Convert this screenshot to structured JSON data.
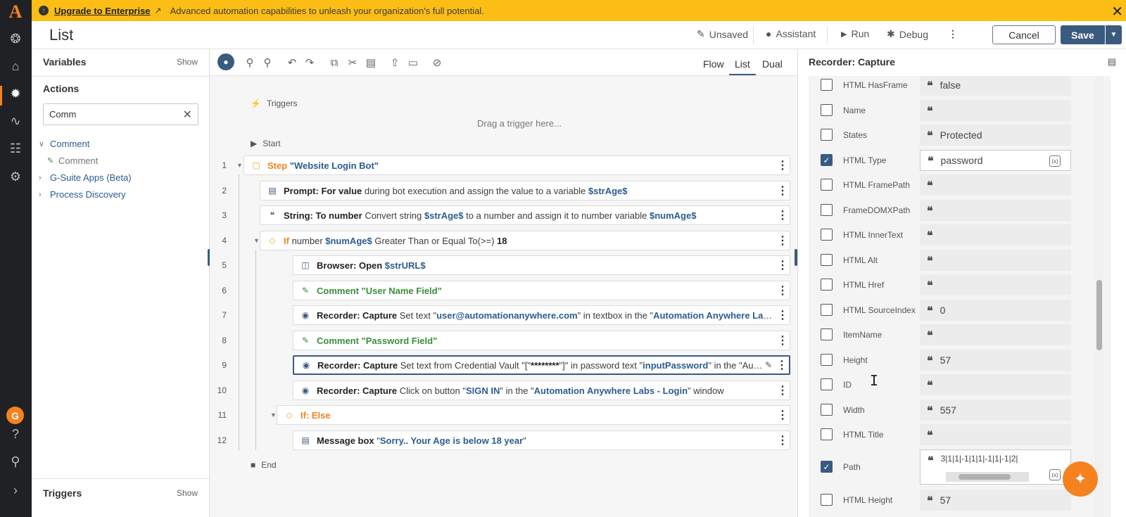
{
  "banner": {
    "link": "Upgrade to Enterprise",
    "message": "Advanced automation capabilities to unleash your organization's full potential."
  },
  "header": {
    "title": "List",
    "unsaved": "Unsaved",
    "assistant": "Assistant",
    "run": "Run",
    "debug": "Debug",
    "cancel": "Cancel",
    "save": "Save"
  },
  "rail": {
    "avatar_initial": "G"
  },
  "left_panel": {
    "variables": "Variables",
    "variables_show": "Show",
    "actions": "Actions",
    "search_value": "Comm",
    "tree": [
      {
        "label": "Comment",
        "expanded": true
      },
      {
        "label": "Comment",
        "child": true
      },
      {
        "label": "G-Suite Apps (Beta)"
      },
      {
        "label": "Process Discovery"
      }
    ],
    "triggers": "Triggers",
    "triggers_show": "Show"
  },
  "toolbar": {
    "tabs": [
      "Flow",
      "List",
      "Dual"
    ],
    "active_tab": "List"
  },
  "canvas": {
    "triggers_label": "Triggers",
    "drag_hint": "Drag a trigger here...",
    "start_label": "Start",
    "end_label": "End",
    "lines": [
      {
        "no": "1",
        "parts": [
          [
            "step",
            "Step "
          ],
          [
            "str",
            "\"Website Login Bot\""
          ]
        ]
      },
      {
        "no": "2",
        "parts": [
          [
            "act",
            "Prompt: For value"
          ],
          [
            "",
            " during bot execution and assign the value to a variable "
          ],
          [
            "var",
            "$strAge$"
          ]
        ]
      },
      {
        "no": "3",
        "parts": [
          [
            "act",
            "String: To number"
          ],
          [
            "",
            " Convert string "
          ],
          [
            "var",
            "$strAge$"
          ],
          [
            "",
            " to a number and assign it to number variable "
          ],
          [
            "var",
            "$numAge$"
          ]
        ]
      },
      {
        "no": "4",
        "parts": [
          [
            "step",
            "If"
          ],
          [
            "",
            " number "
          ],
          [
            "var",
            "$numAge$"
          ],
          [
            "",
            " Greater Than or Equal To(>=) "
          ],
          [
            "act",
            "18"
          ]
        ]
      },
      {
        "no": "5",
        "parts": [
          [
            "act",
            "Browser: Open "
          ],
          [
            "var",
            "$strURL$"
          ]
        ]
      },
      {
        "no": "6",
        "parts": [
          [
            "cmt",
            "Comment \"User Name Field\""
          ]
        ]
      },
      {
        "no": "7",
        "parts": [
          [
            "act",
            "Recorder: Capture"
          ],
          [
            "",
            " Set text \""
          ],
          [
            "var",
            "user@automationanywhere.com"
          ],
          [
            "",
            "\" in textbox in the \""
          ],
          [
            "var",
            "Automation Anywhere Labs - Login"
          ],
          [
            "",
            "\" window"
          ]
        ]
      },
      {
        "no": "8",
        "parts": [
          [
            "cmt",
            "Comment \"Password Field\""
          ]
        ]
      },
      {
        "no": "9",
        "parts": [
          [
            "act",
            "Recorder: Capture"
          ],
          [
            "",
            " Set text from Credential Vault \"[\""
          ],
          [
            "act",
            "********"
          ],
          [
            "",
            "\"]\" in password text \""
          ],
          [
            "var",
            "inputPassword"
          ],
          [
            "",
            "\" in the \"Automation Anywhere Labs - Login\" window"
          ]
        ]
      },
      {
        "no": "10",
        "parts": [
          [
            "act",
            "Recorder: Capture"
          ],
          [
            "",
            " Click on button \""
          ],
          [
            "var",
            "SIGN IN"
          ],
          [
            "",
            "\" in the \""
          ],
          [
            "var",
            "Automation Anywhere Labs - Login"
          ],
          [
            "",
            "\" window"
          ]
        ]
      },
      {
        "no": "11",
        "parts": [
          [
            "step",
            "If: Else"
          ]
        ]
      },
      {
        "no": "12",
        "parts": [
          [
            "act",
            "Message box"
          ],
          [
            "",
            " \""
          ],
          [
            "var",
            "Sorry.. Your Age is below 18 year"
          ],
          [
            "",
            "\""
          ]
        ]
      }
    ]
  },
  "right_panel": {
    "title": "Recorder: Capture",
    "props": [
      {
        "label": "HTML HasFrame",
        "value": "false",
        "checked": false
      },
      {
        "label": "Name",
        "value": "",
        "checked": false
      },
      {
        "label": "States",
        "value": "Protected",
        "checked": false
      },
      {
        "label": "HTML Type",
        "value": "password",
        "checked": true
      },
      {
        "label": "HTML FramePath",
        "value": "",
        "checked": false
      },
      {
        "label": "FrameDOMXPath",
        "value": "",
        "checked": false
      },
      {
        "label": "HTML InnerText",
        "value": "",
        "checked": false
      },
      {
        "label": "HTML Alt",
        "value": "",
        "checked": false
      },
      {
        "label": "HTML Href",
        "value": "",
        "checked": false
      },
      {
        "label": "HTML SourceIndex",
        "value": "0",
        "checked": false
      },
      {
        "label": "ItemName",
        "value": "",
        "checked": false
      },
      {
        "label": "Height",
        "value": "57",
        "checked": false
      },
      {
        "label": "ID",
        "value": "",
        "checked": false
      },
      {
        "label": "Width",
        "value": "557",
        "checked": false
      },
      {
        "label": "HTML Title",
        "value": "",
        "checked": false
      },
      {
        "label": "Path",
        "value": "3|1|1|-1|1|1|-1|1|-1|2|",
        "checked": true
      },
      {
        "label": "HTML Height",
        "value": "57",
        "checked": false
      }
    ]
  },
  "colors": {
    "banner": "#fcbd14",
    "primary": "#3b5a80",
    "accent": "#f5821f",
    "rail": "#1f2124"
  }
}
